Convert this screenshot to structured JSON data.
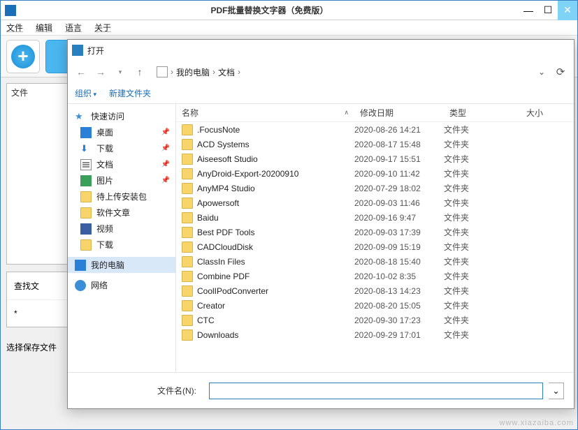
{
  "mainWindow": {
    "title": "PDF批量替换文字器（免费版）",
    "menu": [
      "文件",
      "编辑",
      "语言",
      "关于"
    ],
    "filesHeader": "文件",
    "searchTab": "查找文",
    "saveLabel": "选择保存文件"
  },
  "dialog": {
    "title": "打开",
    "breadcrumb": [
      "我的电脑",
      "文档"
    ],
    "toolbar": {
      "organize": "组织",
      "newFolder": "新建文件夹"
    },
    "sidebar": {
      "quick": "快速访问",
      "items": [
        {
          "label": "桌面",
          "icon": "ico-desktop",
          "pin": true
        },
        {
          "label": "下载",
          "icon": "ico-download",
          "pin": true
        },
        {
          "label": "文档",
          "icon": "ico-doc",
          "pin": true
        },
        {
          "label": "图片",
          "icon": "ico-pic",
          "pin": true
        },
        {
          "label": "待上传安装包",
          "icon": "ico-folder"
        },
        {
          "label": "软件文章",
          "icon": "ico-folder"
        },
        {
          "label": "视频",
          "icon": "ico-video"
        },
        {
          "label": "下载",
          "icon": "ico-folder"
        }
      ],
      "mypc": "我的电脑",
      "network": "网络"
    },
    "columns": {
      "name": "名称",
      "date": "修改日期",
      "type": "类型",
      "size": "大小"
    },
    "folderType": "文件夹",
    "rows": [
      {
        "name": ".FocusNote",
        "date": "2020-08-26 14:21"
      },
      {
        "name": "ACD Systems",
        "date": "2020-08-17 15:48"
      },
      {
        "name": "Aiseesoft Studio",
        "date": "2020-09-17 15:51"
      },
      {
        "name": "AnyDroid-Export-20200910",
        "date": "2020-09-10 11:42"
      },
      {
        "name": "AnyMP4 Studio",
        "date": "2020-07-29 18:02"
      },
      {
        "name": "Apowersoft",
        "date": "2020-09-03 11:46"
      },
      {
        "name": "Baidu",
        "date": "2020-09-16 9:47"
      },
      {
        "name": "Best PDF Tools",
        "date": "2020-09-03 17:39"
      },
      {
        "name": "CADCloudDisk",
        "date": "2020-09-09 15:19"
      },
      {
        "name": "ClassIn Files",
        "date": "2020-08-18 15:40"
      },
      {
        "name": "Combine PDF",
        "date": "2020-10-02 8:35"
      },
      {
        "name": "CoolIPodConverter",
        "date": "2020-08-13 14:23"
      },
      {
        "name": "Creator",
        "date": "2020-08-20 15:05"
      },
      {
        "name": "CTC",
        "date": "2020-09-30 17:23"
      },
      {
        "name": "Downloads",
        "date": "2020-09-29 17:01"
      }
    ],
    "filenameLabel": "文件名(N):",
    "filenameValue": ""
  },
  "watermark": "www.xiazaiba.com"
}
